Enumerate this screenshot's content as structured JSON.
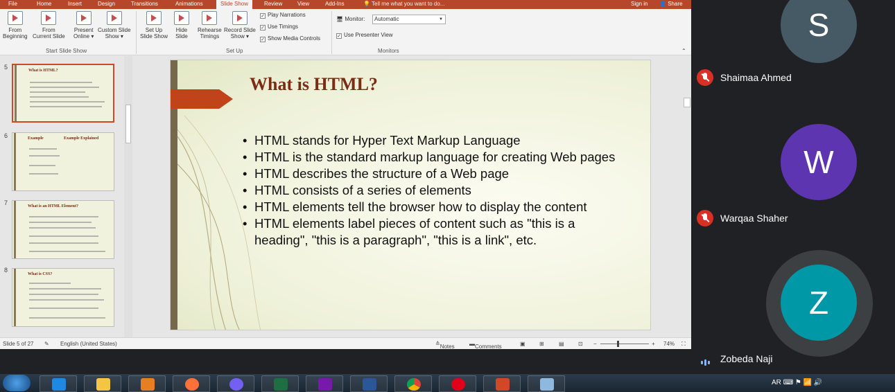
{
  "tabs": [
    "File",
    "Home",
    "Insert",
    "Design",
    "Transitions",
    "Animations",
    "Slide Show",
    "Review",
    "View",
    "Add-Ins"
  ],
  "active_tab": "Slide Show",
  "tell_me": "Tell me what you want to do...",
  "sign_in": "Sign in",
  "share": "Share",
  "ribbon": {
    "from_beginning": [
      "From",
      "Beginning"
    ],
    "from_current": [
      "From",
      "Current Slide"
    ],
    "present_online": [
      "Present",
      "Online ▾"
    ],
    "custom_show": [
      "Custom Slide",
      "Show ▾"
    ],
    "group_start": "Start Slide Show",
    "set_up_show": [
      "Set Up",
      "Slide Show"
    ],
    "hide_slide": [
      "Hide",
      "Slide"
    ],
    "rehearse": [
      "Rehearse",
      "Timings"
    ],
    "record": [
      "Record Slide",
      "Show ▾"
    ],
    "play_narrations": "Play Narrations",
    "use_timings": "Use Timings",
    "show_media": "Show Media Controls",
    "group_setup": "Set Up",
    "monitor_label": "Monitor:",
    "monitor_value": "Automatic",
    "presenter_view": "Use Presenter View",
    "group_monitors": "Monitors"
  },
  "thumbnails": [
    {
      "num": "5",
      "title": "What is HTML?"
    },
    {
      "num": "6",
      "title": "Example",
      "title2": "Example Explained"
    },
    {
      "num": "7",
      "title": "What is an HTML Element?"
    },
    {
      "num": "8",
      "title": "What is CSS?"
    }
  ],
  "slide": {
    "title": "What is HTML?",
    "bullets": [
      " HTML stands for Hyper Text Markup Language",
      "HTML is the standard markup language for creating Web pages",
      "HTML describes the structure of a Web page",
      "HTML consists of a series of elements",
      "HTML elements tell the browser how to display the content",
      "HTML elements label pieces of content such as \"this is a heading\", \"this is a paragraph\", \"this is a link\", etc."
    ]
  },
  "status": {
    "slide_of": "Slide 5 of 27",
    "language": "English (United States)",
    "notes": "Notes",
    "comments": "Comments",
    "zoom": "74%"
  },
  "participants": [
    {
      "initial": "S",
      "name": "Shaimaa Ahmed",
      "color": "#455a64"
    },
    {
      "initial": "W",
      "name": "Warqaa Shaher",
      "color": "#5e35b1"
    },
    {
      "initial": "Z",
      "name": "Zobeda Naji",
      "color": "#0097a7"
    }
  ],
  "tray": {
    "lang": "AR"
  }
}
